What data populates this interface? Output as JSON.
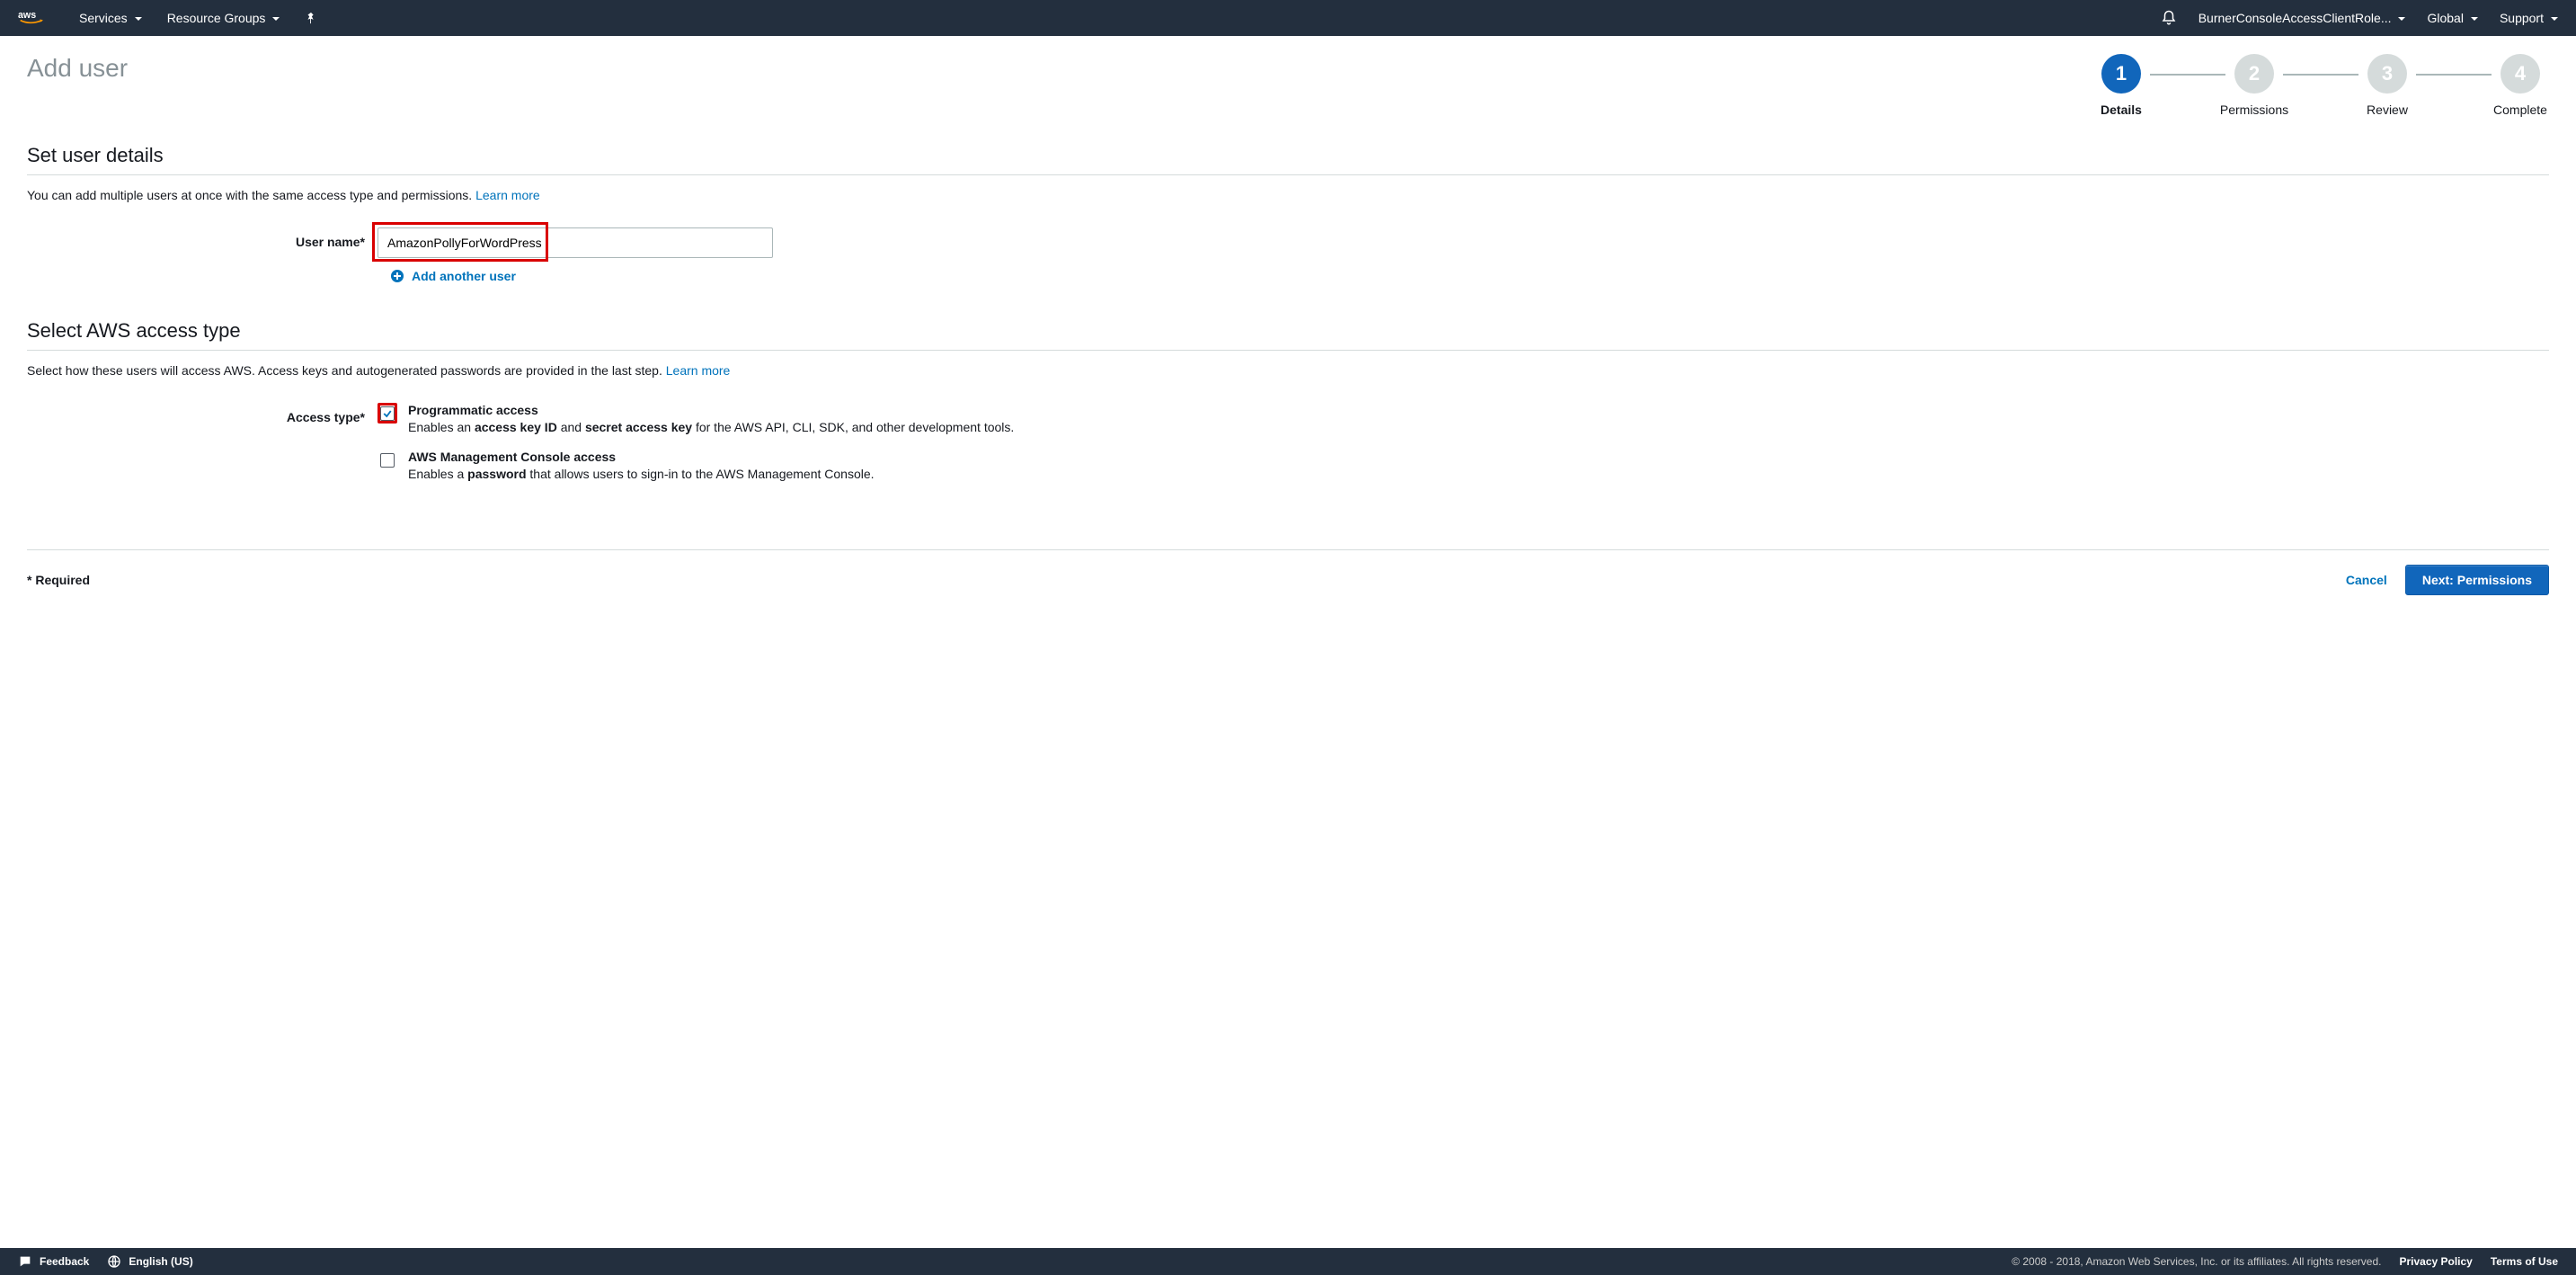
{
  "topnav": {
    "services": "Services",
    "resource_groups": "Resource Groups",
    "role": "BurnerConsoleAccessClientRole...",
    "region": "Global",
    "support": "Support"
  },
  "page_title": "Add user",
  "stepper": {
    "steps": [
      {
        "num": "1",
        "label": "Details"
      },
      {
        "num": "2",
        "label": "Permissions"
      },
      {
        "num": "3",
        "label": "Review"
      },
      {
        "num": "4",
        "label": "Complete"
      }
    ]
  },
  "section_details": {
    "title": "Set user details",
    "desc": "You can add multiple users at once with the same access type and permissions. ",
    "learn_more": "Learn more",
    "username_label": "User name*",
    "username_value": "AmazonPollyForWordPress",
    "add_another": "Add another user"
  },
  "section_access": {
    "title": "Select AWS access type",
    "desc": "Select how these users will access AWS. Access keys and autogenerated passwords are provided in the last step. ",
    "learn_more": "Learn more",
    "access_type_label": "Access type*",
    "programmatic": {
      "title": "Programmatic access",
      "desc_prefix": "Enables an ",
      "bold1": "access key ID",
      "desc_mid": " and ",
      "bold2": "secret access key",
      "desc_suffix": " for the AWS API, CLI, SDK, and other development tools."
    },
    "console": {
      "title": "AWS Management Console access",
      "desc_prefix": "Enables a ",
      "bold1": "password",
      "desc_suffix": " that allows users to sign-in to the AWS Management Console."
    }
  },
  "footer": {
    "required": "* Required",
    "cancel": "Cancel",
    "next": "Next: Permissions"
  },
  "bottombar": {
    "feedback": "Feedback",
    "language": "English (US)",
    "copyright": "© 2008 - 2018, Amazon Web Services, Inc. or its affiliates. All rights reserved.",
    "privacy": "Privacy Policy",
    "terms": "Terms of Use"
  }
}
